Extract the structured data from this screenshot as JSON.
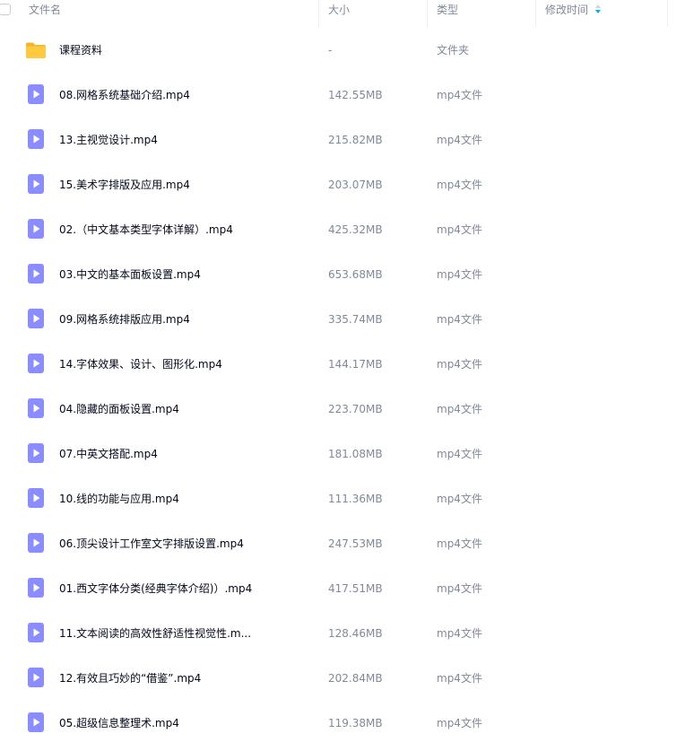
{
  "header": {
    "name_label": "文件名",
    "size_label": "大小",
    "type_label": "类型",
    "modified_label": "修改时间"
  },
  "colors": {
    "folder": "#ffc940",
    "video_icon": "#8a8cff",
    "sort_arrow": "#06a7ff",
    "text_primary": "#03081a",
    "text_secondary": "#818999"
  },
  "files": [
    {
      "icon": "folder-icon",
      "name": "课程资料",
      "size": "-",
      "type": "文件夹"
    },
    {
      "icon": "video-file-icon",
      "name": "08.网格系统基础介绍.mp4",
      "size": "142.55MB",
      "type": "mp4文件"
    },
    {
      "icon": "video-file-icon",
      "name": "13.主视觉设计.mp4",
      "size": "215.82MB",
      "type": "mp4文件"
    },
    {
      "icon": "video-file-icon",
      "name": "15.美术字排版及应用.mp4",
      "size": "203.07MB",
      "type": "mp4文件"
    },
    {
      "icon": "video-file-icon",
      "name": "02.（中文基本类型字体详解）.mp4",
      "size": "425.32MB",
      "type": "mp4文件"
    },
    {
      "icon": "video-file-icon",
      "name": "03.中文的基本面板设置.mp4",
      "size": "653.68MB",
      "type": "mp4文件"
    },
    {
      "icon": "video-file-icon",
      "name": "09.网格系统排版应用.mp4",
      "size": "335.74MB",
      "type": "mp4文件"
    },
    {
      "icon": "video-file-icon",
      "name": "14.字体效果、设计、图形化.mp4",
      "size": "144.17MB",
      "type": "mp4文件"
    },
    {
      "icon": "video-file-icon",
      "name": "04.隐藏的面板设置.mp4",
      "size": "223.70MB",
      "type": "mp4文件"
    },
    {
      "icon": "video-file-icon",
      "name": "07.中英文搭配.mp4",
      "size": "181.08MB",
      "type": "mp4文件"
    },
    {
      "icon": "video-file-icon",
      "name": "10.线的功能与应用.mp4",
      "size": "111.36MB",
      "type": "mp4文件"
    },
    {
      "icon": "video-file-icon",
      "name": "06.顶尖设计工作室文字排版设置.mp4",
      "size": "247.53MB",
      "type": "mp4文件"
    },
    {
      "icon": "video-file-icon",
      "name": "01.西文字体分类(经典字体介绍)）.mp4",
      "size": "417.51MB",
      "type": "mp4文件"
    },
    {
      "icon": "video-file-icon",
      "name": "11.文本阅读的高效性舒适性视觉性.m...",
      "size": "128.46MB",
      "type": "mp4文件"
    },
    {
      "icon": "video-file-icon",
      "name": "12.有效且巧妙的“借鉴”.mp4",
      "size": "202.84MB",
      "type": "mp4文件"
    },
    {
      "icon": "video-file-icon",
      "name": "05.超级信息整理术.mp4",
      "size": "119.38MB",
      "type": "mp4文件"
    }
  ]
}
